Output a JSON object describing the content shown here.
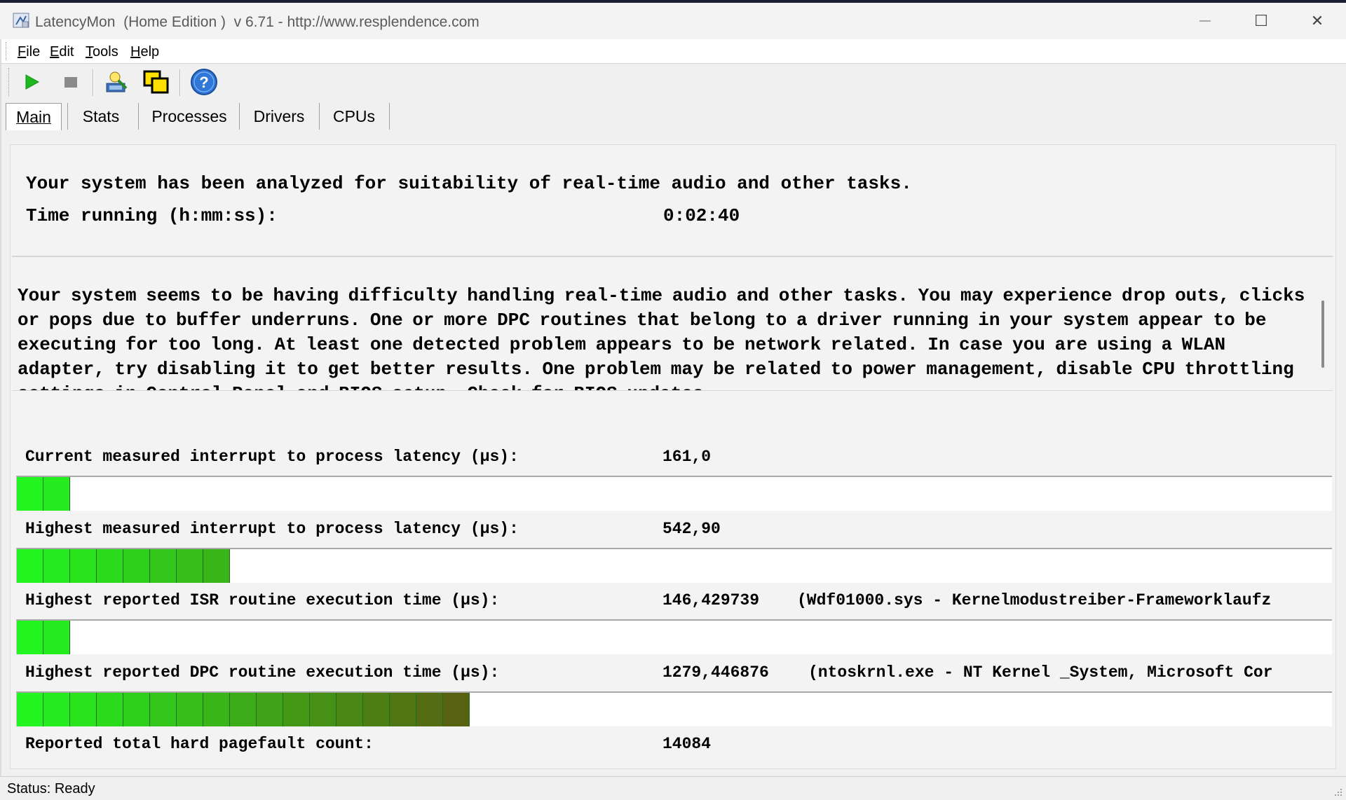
{
  "window": {
    "title": "LatencyMon  (Home Edition )  v 6.71 - http://www.resplendence.com",
    "minimize_glyph": "—",
    "maximize_glyph": "☐",
    "close_glyph": "✕"
  },
  "menu": [
    "File",
    "Edit",
    "Tools",
    "Help"
  ],
  "toolbar": {
    "icons": [
      "play-icon",
      "stop-icon",
      "analyze-icon",
      "windows-icon",
      "help-icon"
    ]
  },
  "tabs": [
    "Main",
    "Stats",
    "Processes",
    "Drivers",
    "CPUs"
  ],
  "active_tab": "Main",
  "summary": {
    "line1": "Your system has been analyzed for suitability of real-time audio and other tasks.",
    "time_label": "Time running (h:mm:ss):",
    "time_value": "0:02:40"
  },
  "message": "Your system seems to be having difficulty handling real-time audio and other tasks. You may experience drop outs, clicks or pops due to buffer underruns. One or more DPC routines that belong to a driver running in your system appear to be executing for too long. At least one detected problem appears to be network related. In case you are using a WLAN adapter, try disabling it to get better results. One problem may be related to power management, disable CPU throttling settings in Control Panel and BIOS setup. Check for BIOS updates.",
  "metrics": [
    {
      "label": "Current measured interrupt to process latency (µs):",
      "value": "161,0",
      "detail": "",
      "bar_segments": 2
    },
    {
      "label": "Highest measured interrupt to process latency (µs):",
      "value": "542,90",
      "detail": "",
      "bar_segments": 8
    },
    {
      "label": "Highest reported ISR routine execution time (µs):",
      "value": "146,429739",
      "detail": "(Wdf01000.sys - Kernelmodustreiber-Frameworklaufz",
      "bar_segments": 2
    },
    {
      "label": "Highest reported DPC routine execution time (µs):",
      "value": "1279,446876",
      "detail": "(ntoskrnl.exe - NT Kernel _System, Microsoft Cor",
      "bar_segments": 17
    }
  ],
  "pagefault": {
    "label": "Reported total hard pagefault count:",
    "value": "14084"
  },
  "status": "Status: Ready",
  "colors": {
    "bar_start": "#22f51f",
    "bar_end": "#5a5a10",
    "play": "#1fb81f",
    "help": "#2f78d8"
  }
}
